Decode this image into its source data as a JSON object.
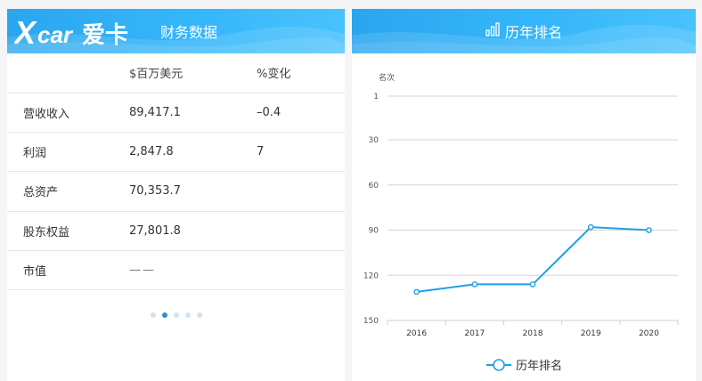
{
  "left_panel": {
    "title": "财务数据",
    "table": {
      "headers": [
        "",
        "$百万美元",
        "%变化"
      ],
      "rows": [
        {
          "label": "营收收入",
          "value": "89,417.1",
          "change": "–0.4"
        },
        {
          "label": "利润",
          "value": "2,847.8",
          "change": "7"
        },
        {
          "label": "总资产",
          "value": "70,353.7",
          "change": ""
        },
        {
          "label": "股东权益",
          "value": "27,801.8",
          "change": ""
        },
        {
          "label": "市值",
          "value": "——",
          "change": ""
        }
      ]
    },
    "pager": {
      "count": 5,
      "active_index": 1
    }
  },
  "right_panel": {
    "title": "历年排名",
    "icon": "bar-chart-icon"
  },
  "chart_data": {
    "type": "line",
    "ylabel": "名次",
    "x": [
      "2016",
      "2017",
      "2018",
      "2019",
      "2020"
    ],
    "y_ticks": [
      1,
      30,
      60,
      90,
      120,
      150
    ],
    "ylim": [
      1,
      150
    ],
    "y_inverted": true,
    "grid": true,
    "legend_position": "bottom-center",
    "series": [
      {
        "name": "历年排名",
        "values": [
          131,
          126,
          126,
          88,
          90
        ],
        "color": "#1ea0e6"
      }
    ]
  },
  "colors": {
    "header_blue": "#37b8fb",
    "accent": "#1ea0e6",
    "dot_active": "#2a8fd3"
  }
}
